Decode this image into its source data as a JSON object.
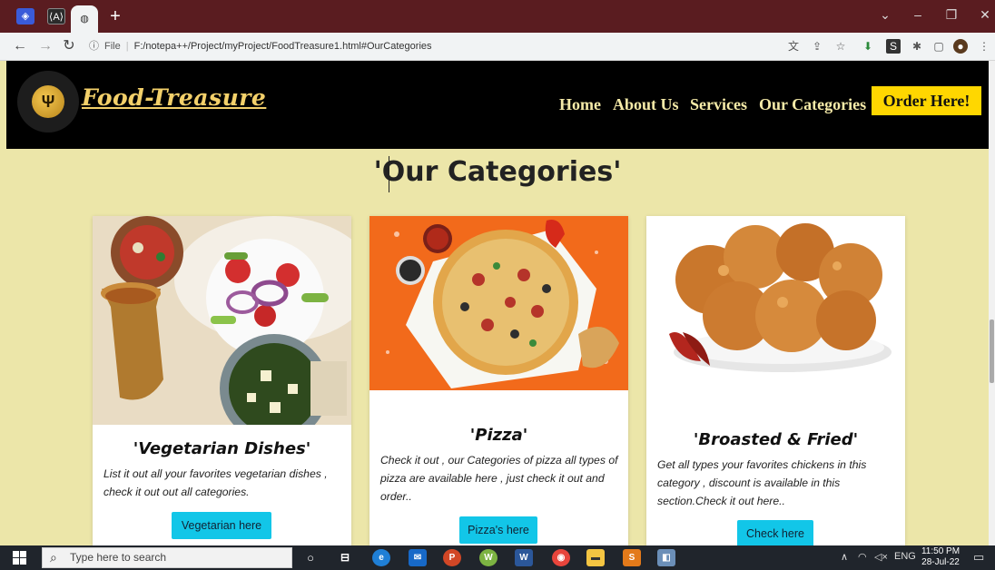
{
  "browser": {
    "url_prefix": "File",
    "url": "F:/notepa++/Project/myProject/FoodTreasure1.html#OurCategories",
    "new_tab_label": "+"
  },
  "site": {
    "brand": "Food-Treasure",
    "nav": [
      "Home",
      "About Us",
      "Services",
      "Our Categories"
    ],
    "order_button": "Order Here!"
  },
  "section": {
    "title": "'Our Categories'"
  },
  "cards": [
    {
      "title": "'Vegetarian Dishes'",
      "text": "List it out all your favorites vegetarian dishes , check it out out all categories.",
      "button": "Vegetarian here"
    },
    {
      "title": "'Pizza'",
      "text": "Check it out , our Categories of pizza all types of pizza are available here , just check it out and order..",
      "button": "Pizza's here"
    },
    {
      "title": "'Broasted & Fried'",
      "text": "Get all types your favorites chickens in this category , discount is available in this section.Check it out here..",
      "button": "Check here"
    }
  ],
  "taskbar": {
    "search_placeholder": "Type here to search",
    "language": "ENG",
    "time": "11:50 PM",
    "date": "28-Jul-22"
  },
  "colors": {
    "page_bg": "#ece6a9",
    "header_bg": "#000000",
    "accent_yellow": "#ffd700",
    "button_cyan": "#12c6e8",
    "tab_strip": "#5a1c20"
  }
}
